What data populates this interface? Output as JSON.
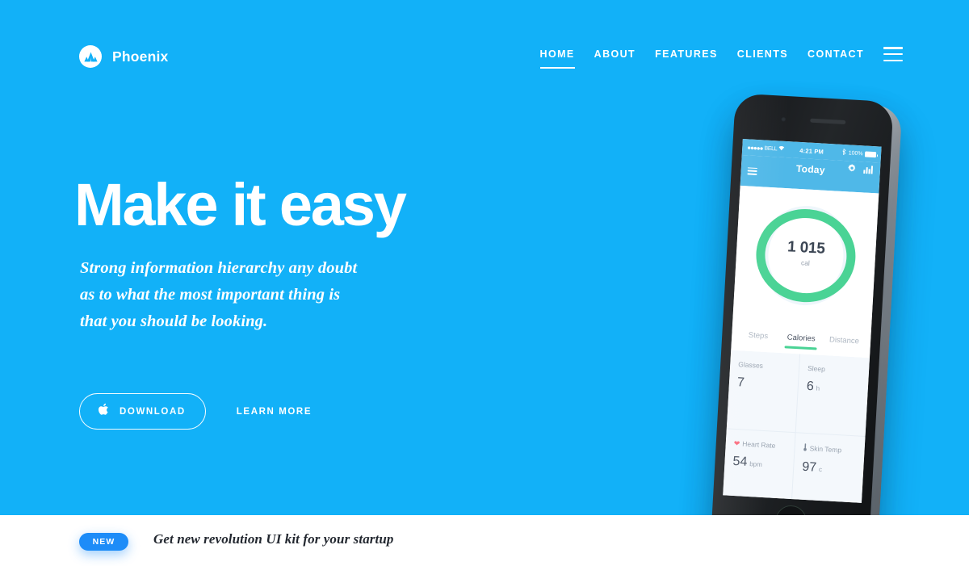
{
  "theme": {
    "hero_bg": "#12b1f8",
    "accent_blue": "#1d8cf8",
    "phone_accent": "#4fb8e8",
    "ring_green": "#4ad395",
    "heart_pink": "#fb6d7f",
    "text_dark": "#232830"
  },
  "brand": {
    "name": "Phoenix",
    "logo_icon": "mountain-logo-icon"
  },
  "nav": {
    "items": [
      {
        "label": "HOME",
        "active": true
      },
      {
        "label": "ABOUT",
        "active": false
      },
      {
        "label": "FEATURES",
        "active": false
      },
      {
        "label": "CLIENTS",
        "active": false
      },
      {
        "label": "CONTACT",
        "active": false
      }
    ],
    "menu_icon": "hamburger-menu-icon"
  },
  "hero": {
    "headline": "Make it easy",
    "subhead_lines": [
      "Strong information hierarchy any doubt",
      "as to what the most important thing is",
      "that you should be looking."
    ],
    "download_label": "DOWNLOAD",
    "download_icon": "apple-logo-icon",
    "learn_more_label": "LEARN MORE"
  },
  "promo": {
    "badge": "NEW",
    "text": "Get new revolution UI kit for your startup"
  },
  "phone": {
    "status_bar": {
      "carrier_dots": "●●●●●",
      "carrier": "BELL",
      "wifi_icon": "wifi-icon",
      "time": "4:21 PM",
      "bluetooth_icon": "bluetooth-icon",
      "battery_pct": "100%",
      "battery_icon": "battery-full-icon"
    },
    "app_header": {
      "title": "Today",
      "menu_icon": "hamburger-menu-icon",
      "settings_icon": "gear-icon",
      "stats_icon": "bar-chart-icon"
    },
    "ring": {
      "value": "1 015",
      "unit": "cal",
      "percent": 85
    },
    "tabs": [
      {
        "label": "Steps",
        "active": false
      },
      {
        "label": "Calories",
        "active": true
      },
      {
        "label": "Distance",
        "active": false
      }
    ],
    "stats": [
      {
        "label": "Glasses",
        "icon": "",
        "value": "7",
        "unit": ""
      },
      {
        "label": "Sleep",
        "icon": "",
        "value": "6",
        "unit": "h"
      },
      {
        "label": "Heart Rate",
        "icon": "heart-icon",
        "value": "54",
        "unit": "bpm"
      },
      {
        "label": "Skin Temp",
        "icon": "thermometer-icon",
        "value": "97",
        "unit": "c"
      }
    ]
  }
}
